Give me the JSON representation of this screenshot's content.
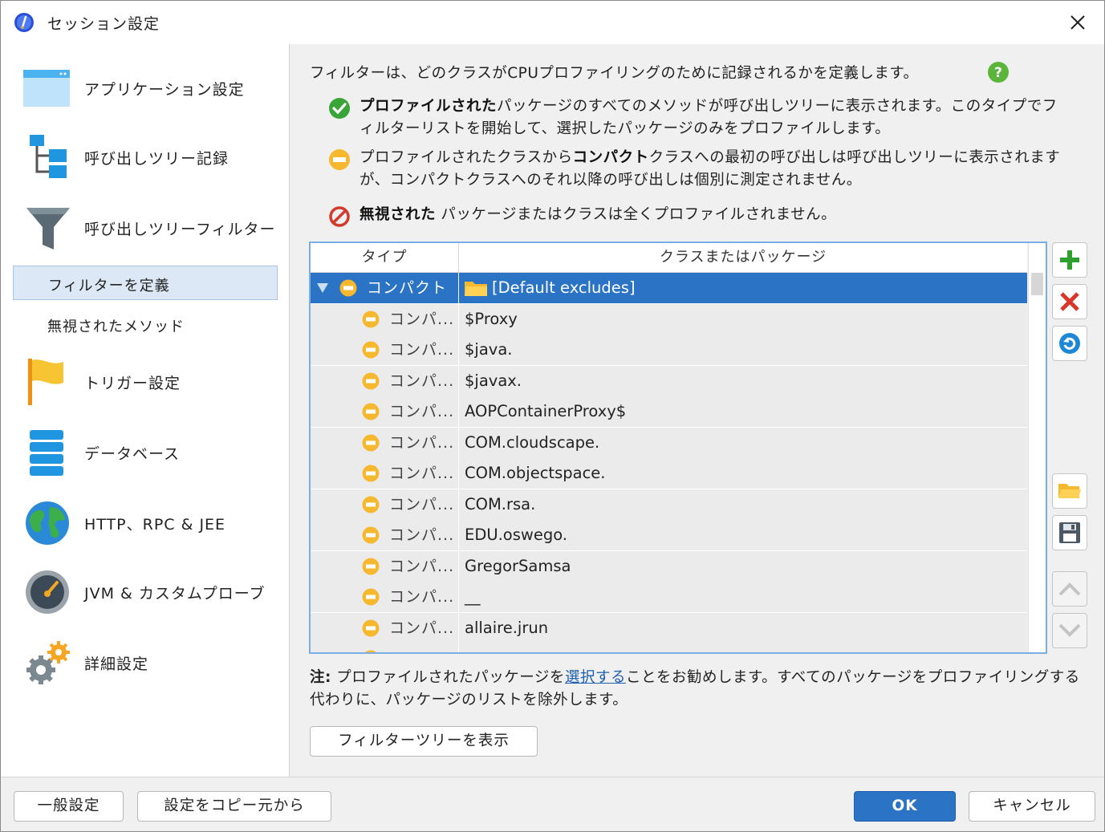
{
  "window": {
    "title": "セッション設定"
  },
  "sidebar": {
    "items": [
      {
        "label": "アプリケーション設定",
        "icon": "app-window-icon"
      },
      {
        "label": "呼び出しツリー記録",
        "icon": "tree-icon"
      },
      {
        "label": "呼び出しツリーフィルター",
        "icon": "funnel-icon"
      },
      {
        "label": "トリガー設定",
        "icon": "flag-icon"
      },
      {
        "label": "データベース",
        "icon": "database-icon"
      },
      {
        "label": "HTTP、RPC & JEE",
        "icon": "globe-icon"
      },
      {
        "label": "JVM & カスタムプローブ",
        "icon": "gauge-icon"
      },
      {
        "label": "詳細設定",
        "icon": "gears-icon"
      }
    ],
    "subitems": [
      {
        "label": "フィルターを定義",
        "selected": true
      },
      {
        "label": "無視されたメソッド",
        "selected": false
      }
    ]
  },
  "content": {
    "description": "フィルターは、どのクラスがCPUプロファイリングのために記録されるかを定義します。",
    "legend": {
      "profiled_bold": "プロファイルされた",
      "profiled_text": "パッケージのすべてのメソッドが呼び出しツリーに表示されます。このタイプでフィルターリストを開始して、選択したパッケージのみをプロファイルします。",
      "compact_pre": "プロファイルされたクラスから",
      "compact_bold": "コンパクト",
      "compact_text": "クラスへの最初の呼び出しは呼び出しツリーに表示されますが、コンパクトクラスへのそれ以降の呼び出しは個別に測定されません。",
      "ignored_bold": "無視された",
      "ignored_text": "パッケージまたはクラスは全くプロファイルされません。"
    },
    "table": {
      "columns": [
        "タイプ",
        "クラスまたはパッケージ"
      ],
      "group": {
        "type": "コンパクト",
        "name": "[Default excludes]"
      },
      "rows": [
        {
          "type": "コンパ...",
          "name": "$Proxy"
        },
        {
          "type": "コンパ...",
          "name": "$java."
        },
        {
          "type": "コンパ...",
          "name": "$javax."
        },
        {
          "type": "コンパ...",
          "name": "AOPContainerProxy$"
        },
        {
          "type": "コンパ...",
          "name": "COM.cloudscape."
        },
        {
          "type": "コンパ...",
          "name": "COM.objectspace."
        },
        {
          "type": "コンパ...",
          "name": "COM.rsa."
        },
        {
          "type": "コンパ...",
          "name": "EDU.oswego."
        },
        {
          "type": "コンパ...",
          "name": "GregorSamsa"
        },
        {
          "type": "コンパ...",
          "name": "__"
        },
        {
          "type": "コンパ...",
          "name": "allaire.jrun"
        }
      ]
    },
    "note": {
      "label": "注:",
      "pre": "プロファイルされたパッケージを",
      "link": "選択する",
      "post": "ことをお勧めします。すべてのパッケージをプロファイリングする代わりに、パッケージのリストを除外します。"
    },
    "show_tree_button": "フィルターツリーを表示"
  },
  "footer": {
    "general_settings": "一般設定",
    "copy_settings": "設定をコピー元から",
    "ok": "OK",
    "cancel": "キャンセル"
  },
  "colors": {
    "accent": "#2a73c5",
    "add": "#2ea02e",
    "remove": "#d8372a",
    "compact": "#f5b82e"
  }
}
